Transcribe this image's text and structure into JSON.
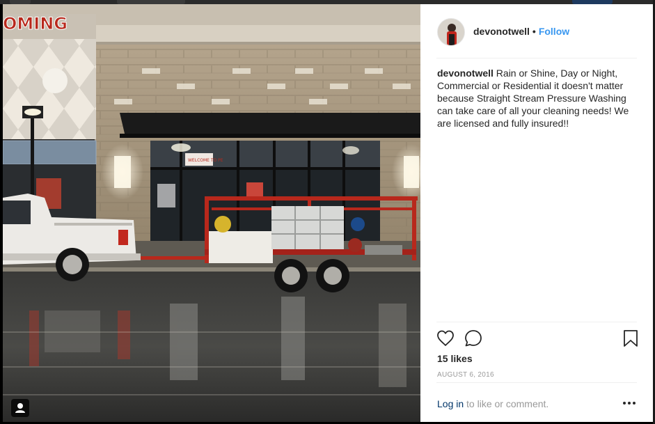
{
  "post": {
    "username": "devonotwell",
    "separator": "•",
    "follow_label": "Follow",
    "caption_user": "devonotwell",
    "caption_text": " Rain or Shine, Day or Night, Commercial or Residential it doesn't matter because Straight Stream Pressure Washing can take care of all your cleaning needs! We are licensed and fully insured!!",
    "likes": "15 likes",
    "date": "AUGUST 6, 2016",
    "login_link": "Log in",
    "comment_prompt": " to like or comment."
  },
  "photo": {
    "store_sign": "OMING",
    "window_sign": "WELCOME TO PE"
  },
  "icons": {
    "like": "heart-outline-icon",
    "comment": "speech-bubble-icon",
    "save": "bookmark-icon",
    "more": "ellipsis-icon",
    "tagged": "user-tag-icon"
  },
  "colors": {
    "link": "#3897f0",
    "text": "#262626",
    "muted": "#999999",
    "trailer_red": "#b8281c"
  }
}
